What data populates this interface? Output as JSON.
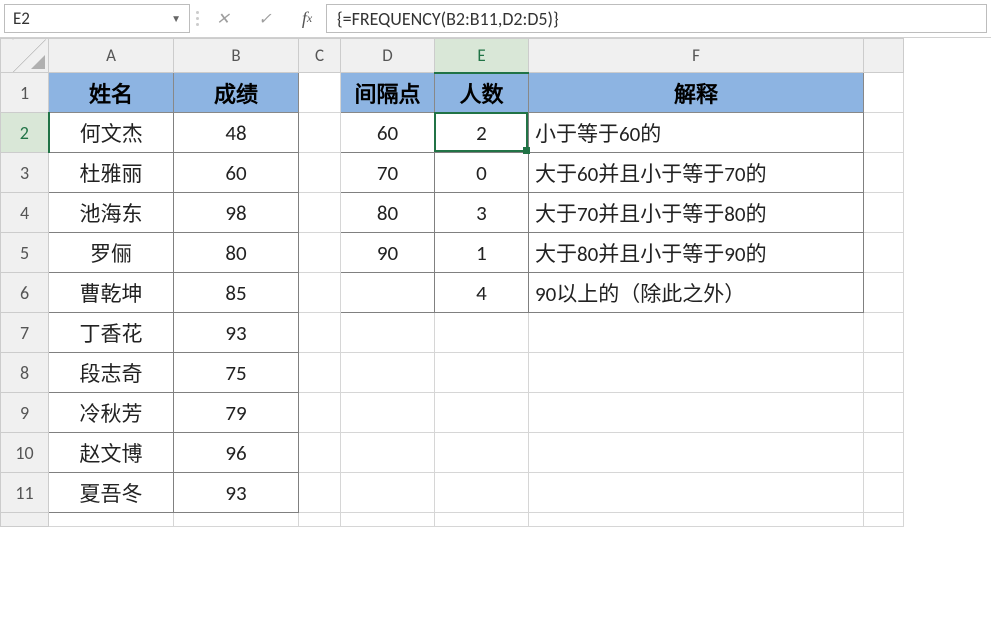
{
  "formula_bar": {
    "name_box": "E2",
    "formula": "{=FREQUENCY(B2:B11,D2:D5)}"
  },
  "columns": [
    "A",
    "B",
    "C",
    "D",
    "E",
    "F"
  ],
  "rows": [
    "1",
    "2",
    "3",
    "4",
    "5",
    "6",
    "7",
    "8",
    "9",
    "10",
    "11"
  ],
  "headers": {
    "A": "姓名",
    "B": "成绩",
    "D": "间隔点",
    "E": "人数",
    "F": "解释"
  },
  "students": [
    {
      "name": "何文杰",
      "score": "48"
    },
    {
      "name": "杜雅丽",
      "score": "60"
    },
    {
      "name": "池海东",
      "score": "98"
    },
    {
      "name": "罗俪",
      "score": "80"
    },
    {
      "name": "曹乾坤",
      "score": "85"
    },
    {
      "name": "丁香花",
      "score": "93"
    },
    {
      "name": "段志奇",
      "score": "75"
    },
    {
      "name": "冷秋芳",
      "score": "79"
    },
    {
      "name": "赵文博",
      "score": "96"
    },
    {
      "name": "夏吾冬",
      "score": "93"
    }
  ],
  "bins": [
    {
      "cut": "60",
      "count": "2",
      "desc": "小于等于60的"
    },
    {
      "cut": "70",
      "count": "0",
      "desc": "大于60并且小于等于70的"
    },
    {
      "cut": "80",
      "count": "3",
      "desc": "大于70并且小于等于80的"
    },
    {
      "cut": "90",
      "count": "1",
      "desc": "大于80并且小于等于90的"
    },
    {
      "cut": "",
      "count": "4",
      "desc": "90以上的（除此之外）"
    }
  ],
  "active_cell": "E2"
}
